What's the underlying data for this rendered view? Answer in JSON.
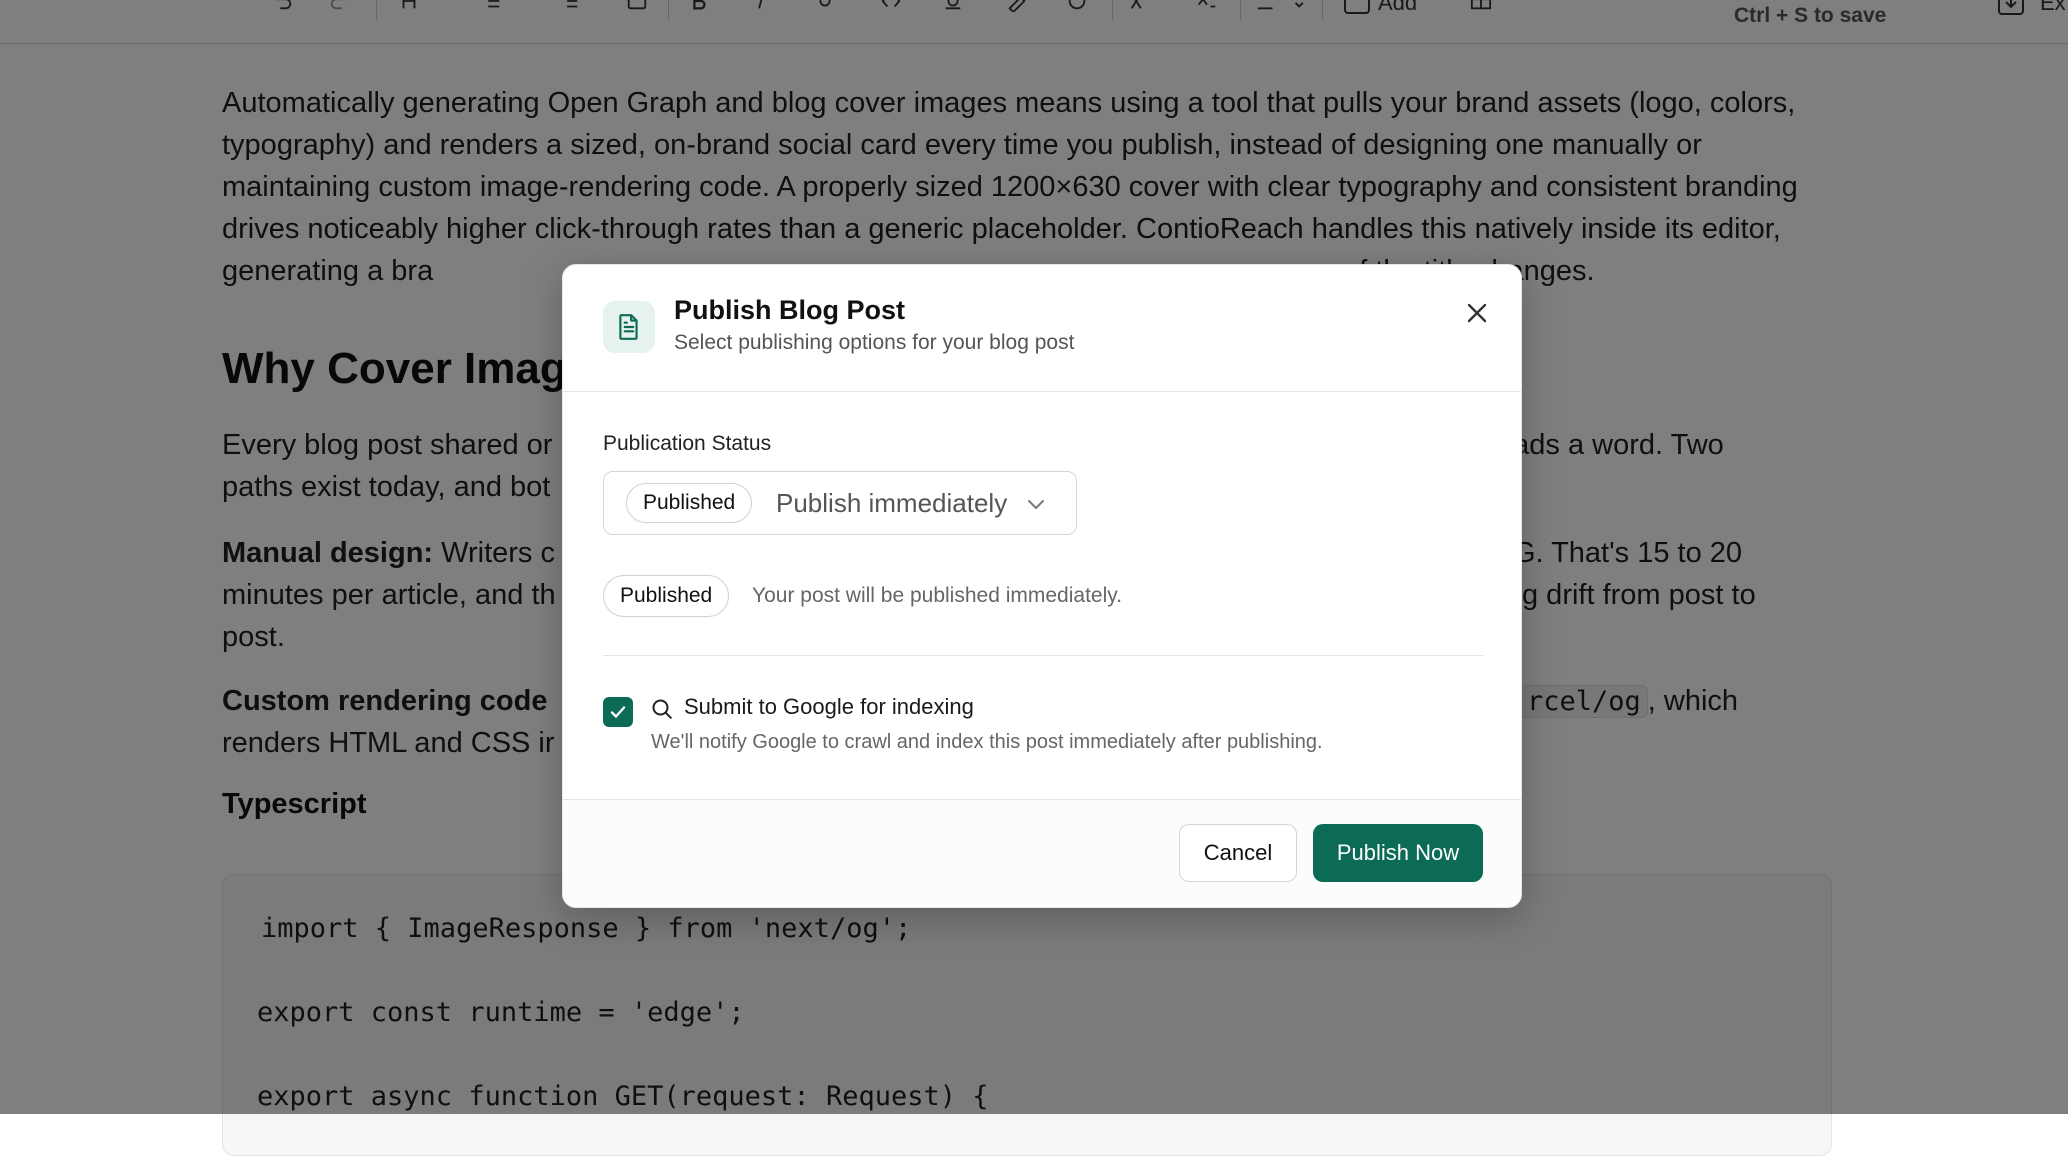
{
  "toolbar": {
    "add_label": "Add",
    "save_hint": "Ctrl + S to save",
    "export_label": "Ex"
  },
  "editor": {
    "p1": "Automatically generating Open Graph and blog cover images means using a tool that pulls your brand assets (logo, colors, typography) and renders a sized, on-brand social card every time you publish, instead of designing one manually or maintaining custom image-rendering code. A properly sized 1200×630 cover with clear typography and consistent branding drives noticeably higher click-through rates than a generic placeholder. ContioReach handles this natively inside its editor, generating a bra",
    "p1_end": "f the title changes.",
    "h2": "Why Cover Imag",
    "p2_a": "Every blog post shared or",
    "p2_b": "eads a word. Two",
    "p2_c": "paths exist today, and bot",
    "p3_bold": "Manual design:",
    "p3_a": " Writers c",
    "p3_b": "NG. That's 15 to 20",
    "p3_c": "minutes per article, and th",
    "p3_d": "g drift from post to",
    "p3_e": "post.",
    "p4_bold": "Custom rendering code",
    "p4_code": "rcel/og",
    "p4_a": ", which",
    "p4_b": "renders HTML and CSS ir",
    "h4": "Typescript",
    "code": [
      "import { ImageResponse } from 'next/og';",
      "export const runtime = 'edge';",
      "export async function GET(request: Request) {"
    ]
  },
  "modal": {
    "title": "Publish Blog Post",
    "subtitle": "Select publishing options for your blog post",
    "status_label": "Publication Status",
    "select_badge": "Published",
    "select_value": "Publish immediately",
    "status_badge": "Published",
    "status_description": "Your post will be published immediately.",
    "google_checked": true,
    "google_label": "Submit to Google for indexing",
    "google_description": "We'll notify Google to crawl and index this post immediately after publishing.",
    "cancel_label": "Cancel",
    "publish_label": "Publish Now"
  },
  "colors": {
    "accent": "#0b6b55",
    "accent_soft": "#e6f2ee",
    "overlay": "rgba(0,0,0,0.5)"
  }
}
